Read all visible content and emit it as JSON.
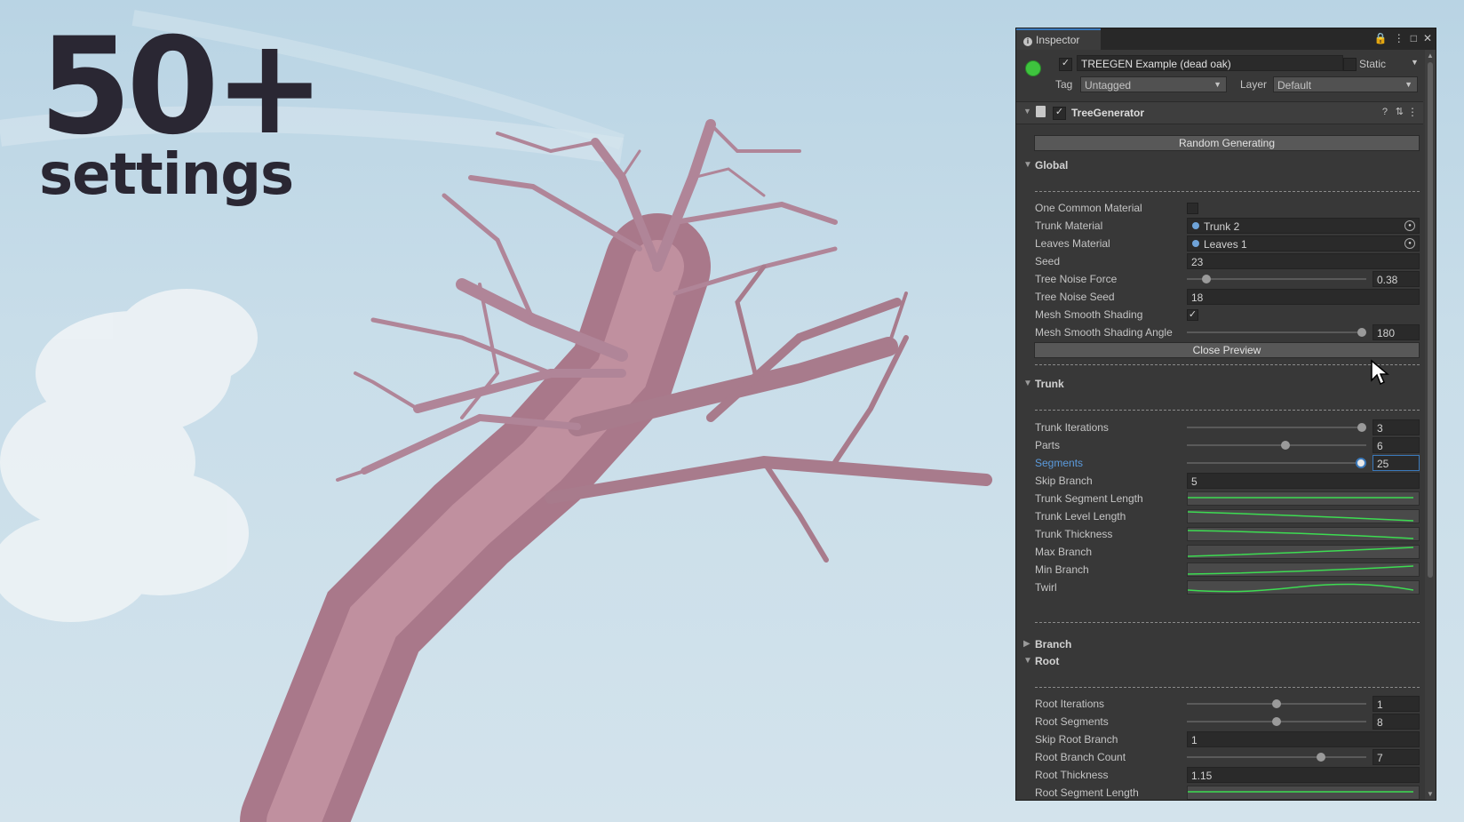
{
  "headline": {
    "number": "50+",
    "subtitle": "settings"
  },
  "colors": {
    "trunk": "#b57f8f",
    "sky": "#c8dde9",
    "accent": "#3a79bb",
    "curve": "#3ddc52"
  },
  "inspector": {
    "tab_label": "Inspector",
    "tab_icons": [
      "lock-icon",
      "menu-icon",
      "maximize-icon",
      "close-icon"
    ],
    "object": {
      "active": true,
      "name": "TREEGEN Example (dead oak)",
      "static_label": "Static",
      "tag_label": "Tag",
      "tag_value": "Untagged",
      "layer_label": "Layer",
      "layer_value": "Default"
    },
    "component": {
      "name": "TreeGenerator",
      "enabled": true
    },
    "random_button": "Random Generating",
    "sections": {
      "global": "Global",
      "trunk": "Trunk",
      "branch": "Branch",
      "root": "Root"
    },
    "global": {
      "one_common_material": {
        "label": "One Common Material",
        "checked": false
      },
      "trunk_material": {
        "label": "Trunk Material",
        "value": "Trunk 2"
      },
      "leaves_material": {
        "label": "Leaves Material",
        "value": "Leaves 1"
      },
      "seed": {
        "label": "Seed",
        "value": "23"
      },
      "tree_noise_force": {
        "label": "Tree Noise Force",
        "value": "0.38",
        "fraction": 0.09
      },
      "tree_noise_seed": {
        "label": "Tree Noise Seed",
        "value": "18"
      },
      "mesh_smooth_shading": {
        "label": "Mesh Smooth Shading",
        "checked": true
      },
      "mesh_smooth_shading_angle": {
        "label": "Mesh Smooth Shading Angle",
        "value": "180",
        "fraction": 1.0
      },
      "close_preview": "Close Preview"
    },
    "trunk": {
      "trunk_iterations": {
        "label": "Trunk Iterations",
        "value": "3",
        "fraction": 1.0
      },
      "parts": {
        "label": "Parts",
        "value": "6",
        "fraction": 0.55
      },
      "segments": {
        "label": "Segments",
        "value": "25",
        "fraction": 1.0
      },
      "skip_branch": {
        "label": "Skip Branch",
        "value": "5"
      },
      "curves": [
        "Trunk Segment Length",
        "Trunk Level Length",
        "Trunk Thickness",
        "Max Branch",
        "Min Branch",
        "Twirl"
      ]
    },
    "root": {
      "root_iterations": {
        "label": "Root Iterations",
        "value": "1",
        "fraction": 0.5
      },
      "root_segments": {
        "label": "Root Segments",
        "value": "8",
        "fraction": 0.5
      },
      "skip_root_branch": {
        "label": "Skip Root Branch",
        "value": "1"
      },
      "root_branch_count": {
        "label": "Root Branch Count",
        "value": "7",
        "fraction": 0.76
      },
      "root_thickness": {
        "label": "Root Thickness",
        "value": "1.15"
      },
      "root_segment_length": {
        "label": "Root Segment Length"
      }
    }
  }
}
